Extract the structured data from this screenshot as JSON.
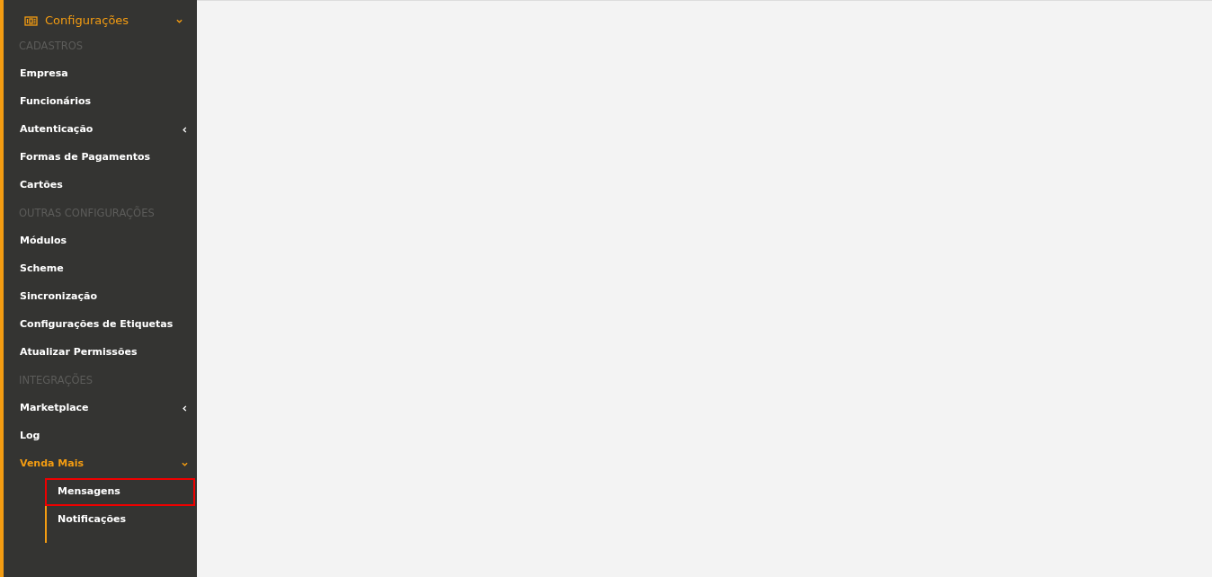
{
  "menu": {
    "label": "Configurações",
    "expanded": true
  },
  "sections": [
    {
      "header": "CADASTROS",
      "items": [
        {
          "label": "Empresa",
          "active": false
        },
        {
          "label": "Funcionários",
          "active": false
        },
        {
          "label": "Autenticação",
          "active": false,
          "expanded": false
        },
        {
          "label": "Formas de Pagamentos",
          "active": false
        },
        {
          "label": "Cartões",
          "active": false
        }
      ]
    },
    {
      "header": "OUTRAS CONFIGURAÇÕES",
      "items": [
        {
          "label": "Módulos",
          "active": false
        },
        {
          "label": "Scheme",
          "active": false
        },
        {
          "label": "Sincronização",
          "active": false
        },
        {
          "label": "Configurações de Etiquetas",
          "active": false
        },
        {
          "label": "Atualizar Permissões",
          "active": false
        }
      ]
    },
    {
      "header": "INTEGRAÇÕES",
      "items": [
        {
          "label": "Marketplace",
          "active": false,
          "expanded": false
        },
        {
          "label": "Log",
          "active": false
        },
        {
          "label": "Venda Mais",
          "active": true,
          "expanded": true,
          "children": [
            {
              "label": "Mensagens",
              "highlighted": true
            },
            {
              "label": "Notificações",
              "highlighted": false
            }
          ]
        }
      ]
    }
  ]
}
